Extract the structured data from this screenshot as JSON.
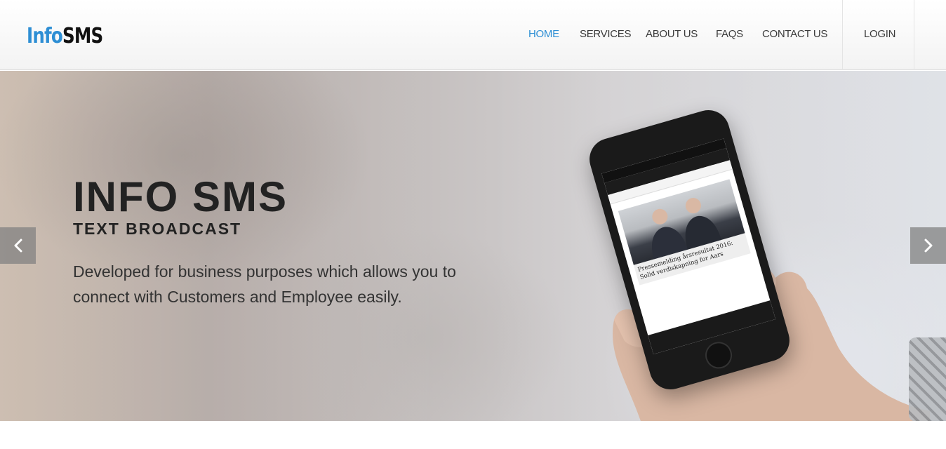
{
  "brand": {
    "logo_part1": "Info",
    "logo_part2": "SMS"
  },
  "nav": {
    "items": [
      {
        "label": "HOME",
        "active": true
      },
      {
        "label": "SERVICES"
      },
      {
        "label": "ABOUT US"
      },
      {
        "label": "FAQS"
      },
      {
        "label": "CONTACT US"
      }
    ],
    "login_label": "LOGIN"
  },
  "hero": {
    "title": "INFO SMS",
    "subtitle": "TEXT BROADCAST",
    "description": "Developed for business purposes which allows you to connect with Customers and Employee easily."
  },
  "slider": {
    "prev_icon": "chevron-left-icon",
    "next_icon": "chevron-right-icon"
  },
  "phone_screen": {
    "caption": "Pressemelding årsresultat 2016: Solid verdiskapning for Aars"
  },
  "colors": {
    "accent": "#2d8ed4",
    "text_dark": "#222222",
    "nav_text": "#3a3a3a",
    "arrow_bg": "#828282"
  }
}
